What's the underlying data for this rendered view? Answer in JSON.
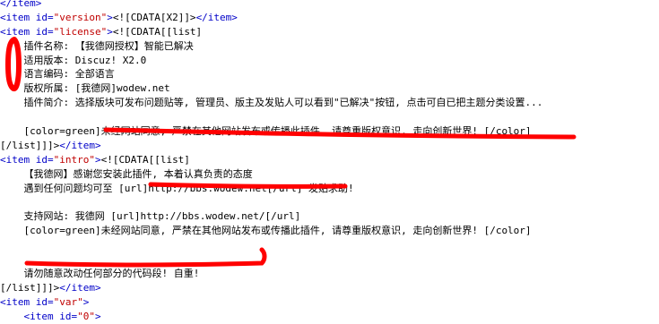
{
  "lines": [
    {
      "indent": "",
      "parts": [
        {
          "c": "tag",
          "t": "</item>"
        }
      ]
    },
    {
      "indent": "",
      "parts": [
        {
          "c": "tag",
          "t": "<item id="
        },
        {
          "c": "attr",
          "t": "\"version\""
        },
        {
          "c": "tag",
          "t": ">"
        },
        {
          "c": "txt",
          "t": "<![CDATA[X2]]>"
        },
        {
          "c": "tag",
          "t": "</item>"
        }
      ]
    },
    {
      "indent": "",
      "parts": [
        {
          "c": "tag",
          "t": "<item id="
        },
        {
          "c": "attr",
          "t": "\"license\""
        },
        {
          "c": "tag",
          "t": ">"
        },
        {
          "c": "txt",
          "t": "<![CDATA[[list]"
        }
      ]
    },
    {
      "indent": "    ",
      "parts": [
        {
          "c": "txt",
          "t": "插件名称: 【我德网授权】智能已解决"
        }
      ]
    },
    {
      "indent": "    ",
      "parts": [
        {
          "c": "txt",
          "t": "适用版本: Discuz! X2.0"
        }
      ]
    },
    {
      "indent": "    ",
      "parts": [
        {
          "c": "txt",
          "t": "语言编码: 全部语言"
        }
      ]
    },
    {
      "indent": "    ",
      "parts": [
        {
          "c": "txt",
          "t": "版权所属: [我德网]wodew.net"
        }
      ]
    },
    {
      "indent": "    ",
      "parts": [
        {
          "c": "txt",
          "t": "插件简介: 选择版块可发布问题贴等, 管理员、版主及发贴人可以看到\"已解决\"按钮, 点击可自已把主题分类设置..."
        }
      ]
    },
    {
      "indent": "",
      "parts": [
        {
          "c": "txt",
          "t": ""
        }
      ]
    },
    {
      "indent": "    ",
      "parts": [
        {
          "c": "txt",
          "t": "[color=green]未经网站同意, 严禁在其他网站发布或传播此插件, 请尊重版权意识, 走向创新世界! [/color]"
        }
      ]
    },
    {
      "indent": "",
      "parts": [
        {
          "c": "txt",
          "t": "[/list]]]>"
        },
        {
          "c": "tag",
          "t": "</item>"
        }
      ]
    },
    {
      "indent": "",
      "parts": [
        {
          "c": "tag",
          "t": "<item id="
        },
        {
          "c": "attr",
          "t": "\"intro\""
        },
        {
          "c": "tag",
          "t": ">"
        },
        {
          "c": "txt",
          "t": "<![CDATA[[list]"
        }
      ]
    },
    {
      "indent": "    ",
      "parts": [
        {
          "c": "txt",
          "t": "【我德网】感谢您安装此插件, 本着认真负责的态度"
        }
      ]
    },
    {
      "indent": "    ",
      "parts": [
        {
          "c": "txt",
          "t": "遇到任何问题均可至 [url]http://bbs.wodew.net[/url] 发贴求助!"
        }
      ]
    },
    {
      "indent": "",
      "parts": [
        {
          "c": "txt",
          "t": ""
        }
      ]
    },
    {
      "indent": "    ",
      "parts": [
        {
          "c": "txt",
          "t": "支持网站: 我德网 [url]http://bbs.wodew.net/[/url]"
        }
      ]
    },
    {
      "indent": "    ",
      "parts": [
        {
          "c": "txt",
          "t": "[color=green]未经网站同意, 严禁在其他网站发布或传播此插件, 请尊重版权意识, 走向创新世界! [/color]"
        }
      ]
    },
    {
      "indent": "",
      "parts": [
        {
          "c": "txt",
          "t": ""
        }
      ]
    },
    {
      "indent": "",
      "parts": [
        {
          "c": "txt",
          "t": ""
        }
      ]
    },
    {
      "indent": "    ",
      "parts": [
        {
          "c": "txt",
          "t": "请勿随意改动任何部分的代码段! 自重!"
        }
      ]
    },
    {
      "indent": "",
      "parts": [
        {
          "c": "txt",
          "t": "[/list]]]>"
        },
        {
          "c": "tag",
          "t": "</item>"
        }
      ]
    },
    {
      "indent": "",
      "parts": [
        {
          "c": "tag",
          "t": "<item id="
        },
        {
          "c": "attr",
          "t": "\"var\""
        },
        {
          "c": "tag",
          "t": ">"
        }
      ]
    },
    {
      "indent": "    ",
      "parts": [
        {
          "c": "tag",
          "t": "<item id="
        },
        {
          "c": "attr",
          "t": "\"0\""
        },
        {
          "c": "tag",
          "t": ">"
        }
      ]
    }
  ],
  "colors": {
    "tag": "#0000c8",
    "attr": "#c00000",
    "text": "#000000",
    "annotation": "#ff0000"
  }
}
